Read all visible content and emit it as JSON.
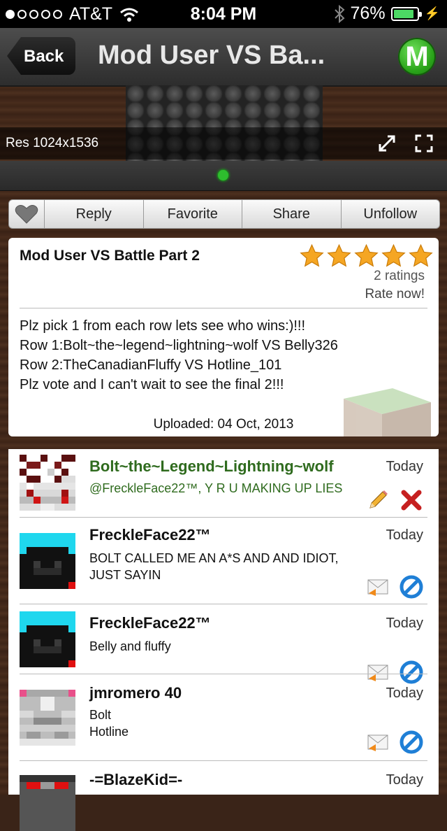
{
  "status_bar": {
    "carrier": "AT&T",
    "time": "8:04 PM",
    "battery": "76%"
  },
  "nav": {
    "back_label": "Back",
    "title": "Mod User VS Ba...",
    "logo_letter": "M"
  },
  "image": {
    "resolution": "Res 1024x1536"
  },
  "toolbar": {
    "reply": "Reply",
    "favorite": "Favorite",
    "share": "Share",
    "unfollow": "Unfollow"
  },
  "post": {
    "title": "Mod User VS Battle Part 2",
    "stars": 5,
    "ratings": "2 ratings",
    "rate_now": "Rate now!",
    "description": [
      "Plz pick 1 from each row lets see who wins:)!!!",
      "Row 1:Bolt~the~legend~lightning~wolf VS Belly326",
      "Row 2:TheCanadianFluffy VS Hotline_101",
      "Plz vote and I can't wait to see the final 2!!!"
    ],
    "uploaded": "Uploaded: 04 Oct, 2013"
  },
  "comments": [
    {
      "user": "Bolt~the~Legend~Lightning~wolf",
      "time": "Today",
      "lines": [
        "@FreckleFace22™, Y R U MAKING UP LIES"
      ],
      "own": true
    },
    {
      "user": "FreckleFace22™",
      "time": "Today",
      "lines": [
        "BOLT CALLED ME AN A*S AND AND IDIOT,",
        "JUST SAYIN"
      ],
      "own": false
    },
    {
      "user": "FreckleFace22™",
      "time": "Today",
      "lines": [
        "Belly and fluffy"
      ],
      "own": false
    },
    {
      "user": "jmromero 40",
      "time": "Today",
      "lines": [
        "Bolt",
        "Hotline"
      ],
      "own": false
    },
    {
      "user": "-=BlazeKid=-",
      "time": "Today",
      "lines": [],
      "own": false
    }
  ],
  "colors": {
    "accent_green": "#2f6b1e",
    "star": "#f5a623",
    "logo_green": "#2aa31a"
  }
}
